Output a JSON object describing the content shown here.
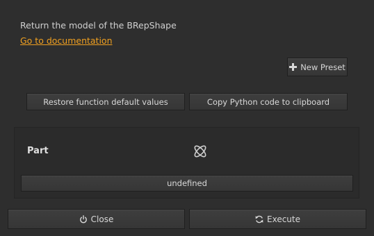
{
  "description": "Return the model of the BRepShape",
  "doc_link": "Go to documentation",
  "toolbar": {
    "new_preset": "New Preset",
    "restore_defaults": "Restore function default values",
    "copy_python": "Copy Python code to clipboard"
  },
  "parameter": {
    "label": "Part",
    "icon": "shape-icon",
    "value": "undefined"
  },
  "footer": {
    "close": "Close",
    "execute": "Execute"
  },
  "colors": {
    "background": "#2e2e2e",
    "link": "#f0a020",
    "text": "#d8d8d8"
  }
}
